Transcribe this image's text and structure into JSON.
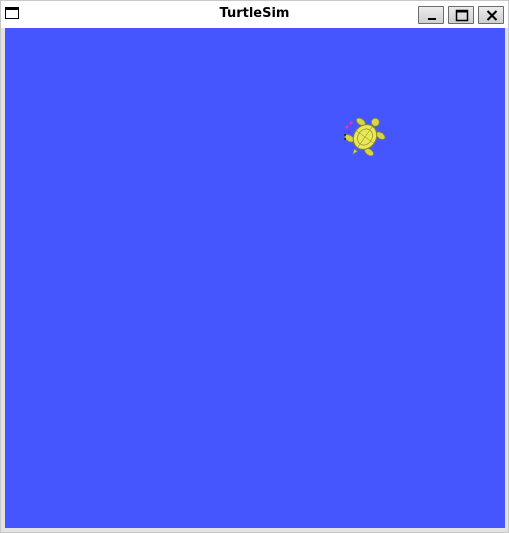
{
  "window": {
    "title": "TurtleSim",
    "buttons": {
      "minimize": "minimize",
      "maximize": "maximize",
      "close": "close"
    }
  },
  "canvas": {
    "background_color": "#4556ff"
  },
  "turtle": {
    "shell_color": "#e8e85a",
    "accent_color": "#b8b830",
    "marker_colors": [
      "#ff2aa0",
      "#222222"
    ]
  },
  "icons": {
    "system_menu": "window-menu-icon",
    "minimize": "minimize-icon",
    "maximize": "maximize-icon",
    "close": "close-icon"
  }
}
